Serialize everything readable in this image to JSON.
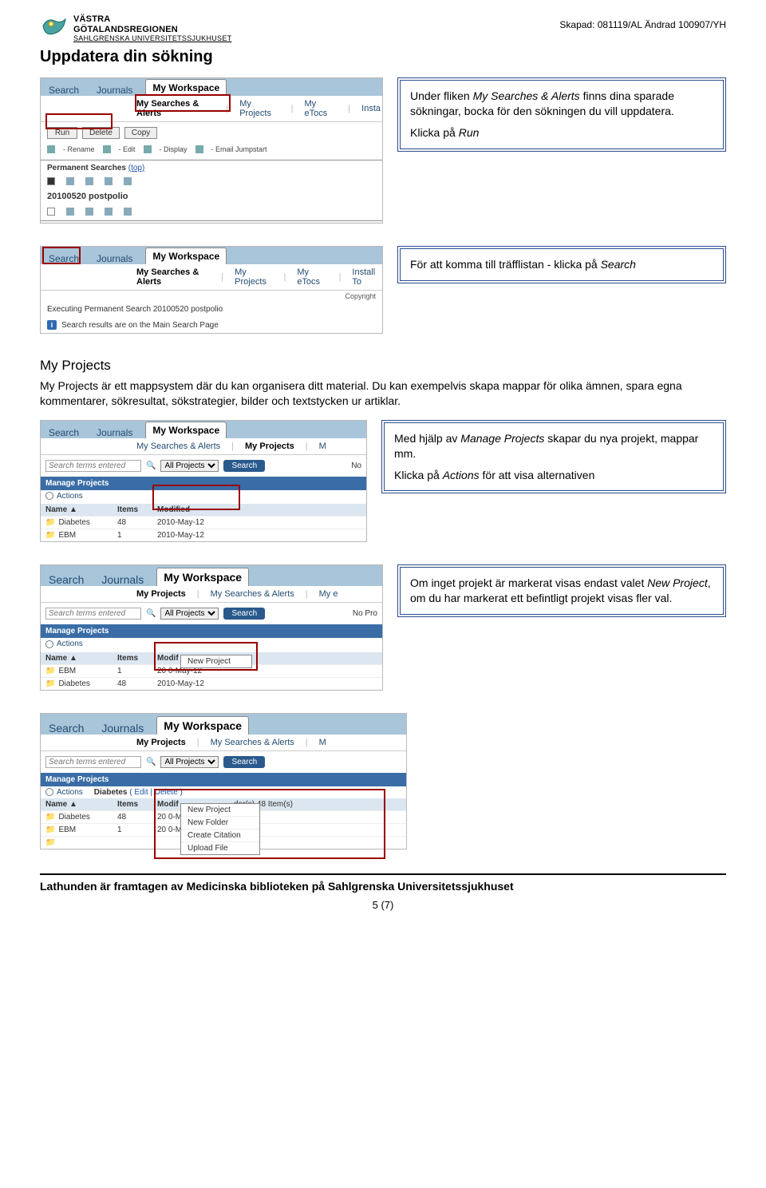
{
  "header": {
    "region": "VÄSTRA",
    "region2": "GÖTALANDSREGIONEN",
    "hospital": "SAHLGRENSKA UNIVERSITETSSJUKHUSET",
    "created": "Skapad: 081119/AL Ändrad 100907/YH"
  },
  "title": "Uppdatera din sökning",
  "tabs": {
    "search": "Search",
    "journals": "Journals",
    "workspace": "My Workspace"
  },
  "subtabs": {
    "msa": "My Searches & Alerts",
    "mp": "My Projects",
    "etocs": "My eTocs",
    "insta": "Insta",
    "install": "Install To",
    "m": "M",
    "mye": "My e"
  },
  "subtabs_order_s2": {
    "mp": "My Projects",
    "msa": "My Searches & Alerts"
  },
  "btns": {
    "run": "Run",
    "delete": "Delete",
    "copy": "Copy"
  },
  "legend": {
    "rename": "- Rename",
    "edit": "- Edit",
    "display": "- Display",
    "email": "- Email Jumpstart"
  },
  "perm": {
    "label": "Permanent Searches",
    "top": "(top)",
    "item": "20100520 postpolio"
  },
  "exec": {
    "line": "Executing Permanent Search 20100520 postpolio",
    "copyright": "Copyright",
    "resultline": "Search results are on the Main Search Page"
  },
  "note1": {
    "p1a": "Under fliken ",
    "p1b": "My Searches & Alerts",
    "p1c": " finns dina sparade sökningar, bocka för den sökningen du vill uppdatera.",
    "p2a": "Klicka på ",
    "p2b": "Run"
  },
  "note2": {
    "p1a": "För att komma till träfflistan - klicka på ",
    "p1b": "Search"
  },
  "section": {
    "h": "My Projects",
    "body": "My Projects är ett mappsystem där du kan organisera ditt material. Du kan exempelvis skapa mappar för olika ämnen, spara egna kommentarer, sökresultat, sökstrategier, bilder och textstycken ur artiklar."
  },
  "searchbar": {
    "placeholder": "Search terms entered",
    "all": "All Projects",
    "btn": "Search",
    "nopro": "No",
    "nopro2": "No Pro"
  },
  "mp": {
    "bar": "Manage Projects",
    "actions": "Actions",
    "col1": "Name",
    "col2": "Items",
    "col3": "Modified",
    "col3b": "Modif",
    "diabetes": "Diabetes",
    "diab_items": "48",
    "diab_date": "2010-May-12",
    "ebm": "EBM",
    "ebm_items": "1",
    "ebm_date": "2010-May-12",
    "newproject": "New Project",
    "newfolder": "New Folder",
    "createcit": "Create Citation",
    "upload": "Upload File",
    "diab_detail_a": "Diabetes",
    "diab_detail_b": "( Edit | Delete )",
    "diab_detail_c": "der(s) 48 Item(s)",
    "date_cut1": "20 0-May-12",
    "date_cut2": "20 0-M"
  },
  "note3": {
    "p1a": "Med hjälp av ",
    "p1b": "Manage Projects",
    "p1c": " skapar du nya projekt, mappar mm.",
    "p2a": "Klicka på ",
    "p2b": "Actions",
    "p2c": " för att visa alternativen"
  },
  "note4": {
    "p1a": "Om inget projekt är markerat visas endast valet ",
    "p1b": "New Project",
    "p1c": ", om du har markerat ett befintligt projekt visas fler val."
  },
  "footer": {
    "text": "Lathunden är framtagen av Medicinska biblioteken på Sahlgrenska Universitetssjukhuset",
    "page": "5 (7)"
  }
}
